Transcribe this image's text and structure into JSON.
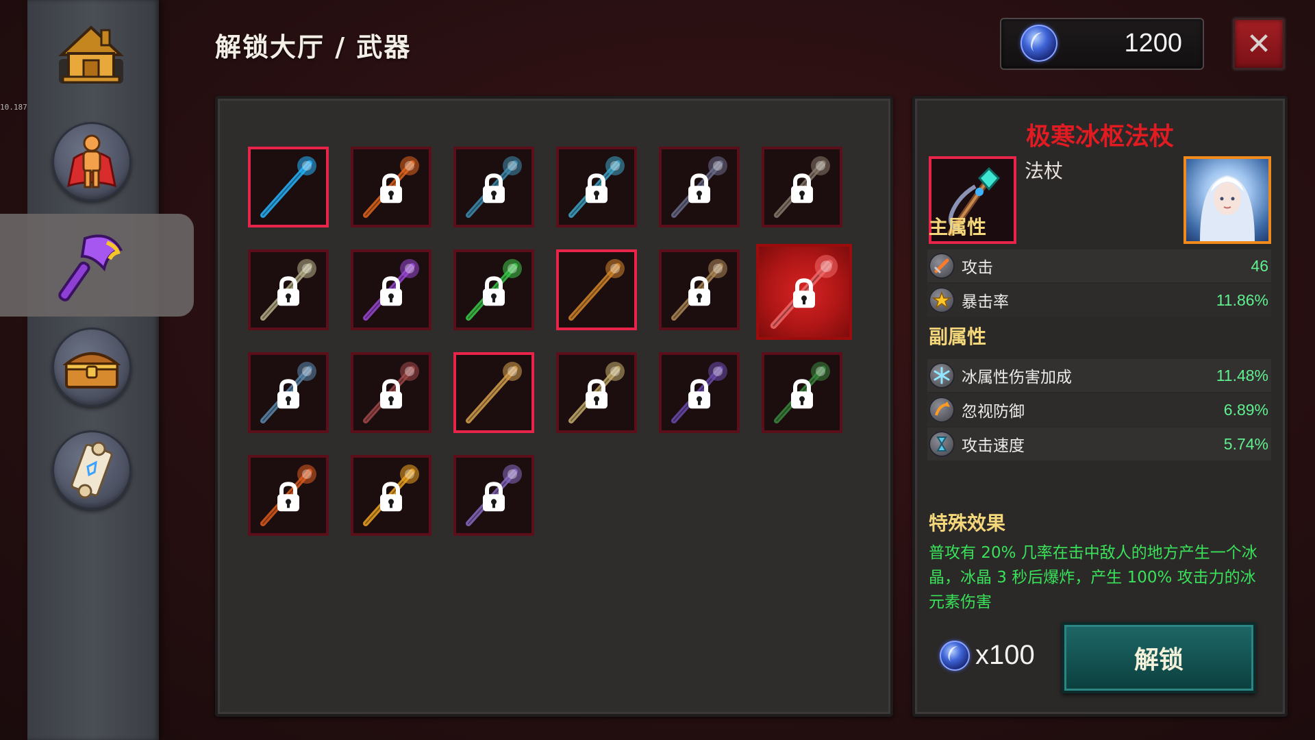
{
  "debug_text": "10.187",
  "title": "解锁大厅 / 武器",
  "currency": {
    "amount": "1200",
    "icon": "blue-orb-icon"
  },
  "close_icon": "✕",
  "sidebar": {
    "items": [
      {
        "id": "home",
        "icon": "home-icon"
      },
      {
        "id": "hero",
        "icon": "hero-icon"
      },
      {
        "id": "weapons",
        "icon": "axe-icon",
        "active": true
      },
      {
        "id": "chest",
        "icon": "treasure-chest-icon"
      },
      {
        "id": "scroll",
        "icon": "scroll-icon"
      }
    ]
  },
  "weapons": [
    {
      "name": "ice-staff",
      "locked": false,
      "color": "#27b6ff"
    },
    {
      "name": "fire-scepter",
      "locked": true,
      "color": "#e3681f"
    },
    {
      "name": "dark-spear",
      "locked": true,
      "color": "#3f8fb3"
    },
    {
      "name": "winged-bow",
      "locked": true,
      "color": "#3fa6c9"
    },
    {
      "name": "thorn-staff",
      "locked": true,
      "color": "#6c6e8c"
    },
    {
      "name": "stone-hammer",
      "locked": true,
      "color": "#8a7c6e"
    },
    {
      "name": "winged-sword",
      "locked": true,
      "color": "#b9b28a"
    },
    {
      "name": "void-staff",
      "locked": true,
      "color": "#9b4ad8"
    },
    {
      "name": "emerald-staff",
      "locked": true,
      "color": "#3ccb4a"
    },
    {
      "name": "bronze-sword",
      "locked": false,
      "color": "#d6882c"
    },
    {
      "name": "war-hammer",
      "locked": true,
      "color": "#b18a57"
    },
    {
      "name": "frost-pivot-staff",
      "locked": true,
      "color": "#f06a6a",
      "selected": true
    },
    {
      "name": "rune-hammer",
      "locked": true,
      "color": "#5d8bb0"
    },
    {
      "name": "shadow-blade",
      "locked": true,
      "color": "#a44a4a"
    },
    {
      "name": "wooden-sword",
      "locked": false,
      "color": "#d9a24e"
    },
    {
      "name": "twin-blade",
      "locked": true,
      "color": "#c7b06d"
    },
    {
      "name": "arcane-tome",
      "locked": true,
      "color": "#6d4db0"
    },
    {
      "name": "serpent-spear",
      "locked": true,
      "color": "#3a8a3e"
    },
    {
      "name": "flame-staff",
      "locked": true,
      "color": "#e05c1f"
    },
    {
      "name": "fire-tome",
      "locked": true,
      "color": "#f0a622"
    },
    {
      "name": "spiked-mace",
      "locked": true,
      "color": "#8a6cc4"
    }
  ],
  "detail": {
    "name": "极寒冰枢法杖",
    "type": "法杖",
    "main_title": "主属性",
    "main_stats": [
      {
        "icon": "sword-icon",
        "label": "攻击",
        "value": "46"
      },
      {
        "icon": "star-icon",
        "label": "暴击率",
        "value": "11.86%"
      }
    ],
    "sub_title": "副属性",
    "sub_stats": [
      {
        "icon": "snowflake-icon",
        "label": "冰属性伤害加成",
        "value": "11.48%"
      },
      {
        "icon": "arrow-icon",
        "label": "忽视防御",
        "value": "6.89%"
      },
      {
        "icon": "hourglass-icon",
        "label": "攻击速度",
        "value": "5.74%"
      }
    ],
    "effect_title": "特殊效果",
    "effect_text": "普攻有 20% 几率在击中敌人的地方产生一个冰晶，冰晶 3 秒后爆炸，产生 100% 攻击力的冰元素伤害",
    "cost": "x100",
    "unlock_label": "解锁"
  }
}
